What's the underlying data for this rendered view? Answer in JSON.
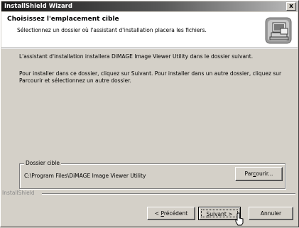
{
  "window": {
    "title": "InstallShield Wizard",
    "close_glyph": "x"
  },
  "header": {
    "title": "Choisissez l'emplacement cible",
    "subtitle": "Sélectionnez un dossier où l'assistant d'installation placera les fichiers.",
    "icon": "computer-install-icon"
  },
  "body": {
    "info1": "L'assistant d'installation installera DiMAGE Image Viewer Utility dans le dossier suivant.",
    "info2": "Pour installer dans ce dossier, cliquez sur Suivant. Pour installer dans un autre dossier, cliquez sur Parcourir et sélectionnez un autre dossier."
  },
  "destination": {
    "legend": "Dossier cible",
    "path": "C:\\Program Files\\DiMAGE Image Viewer Utility",
    "browse": {
      "prefix": "Par",
      "mnemonic": "c",
      "suffix": "ourir..."
    }
  },
  "brand": "InstallShield",
  "buttons": {
    "back": {
      "prefix": "< ",
      "mnemonic": "P",
      "suffix": "récédent"
    },
    "next": {
      "prefix": "",
      "mnemonic": "S",
      "suffix": "uivant >"
    },
    "cancel": "Annuler"
  }
}
